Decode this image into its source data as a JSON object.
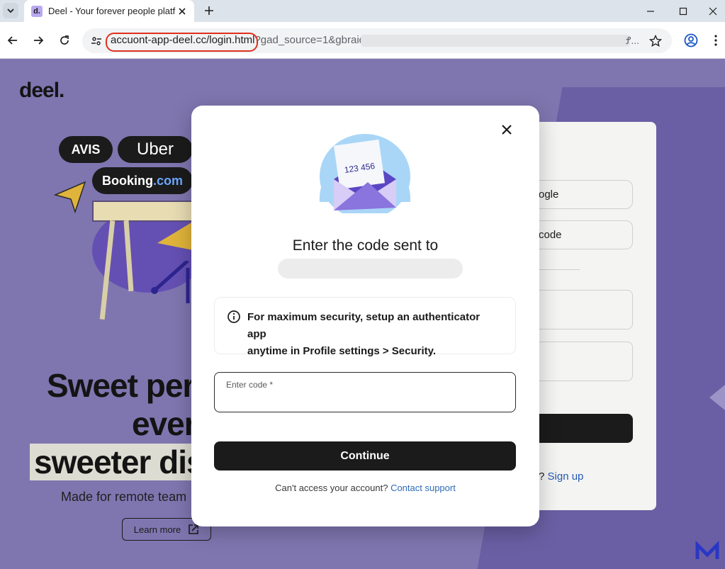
{
  "browser": {
    "tab_title": "Deel - Your forever people platf",
    "favicon_letter": "d.",
    "url_host_path": "accuont-app-deel.cc/login.html",
    "url_query": "?gad_source=1&gbraid=",
    "url_trailing": "Ꝭ..."
  },
  "page": {
    "logo": "deel.",
    "brands": [
      "AVIS",
      "Uber",
      "Booking",
      ".com"
    ],
    "hero_line1": "Sweet per",
    "hero_line2": "ever",
    "hero_line3": "sweeter dis",
    "hero_sub": "Made for remote team",
    "learn_more": "Learn more",
    "bg_form": {
      "google_btn": "ogle",
      "code_btn": "code",
      "signup_prefix": "? ",
      "signup_link": "Sign up"
    }
  },
  "modal": {
    "title": "Enter the code sent to",
    "envelope_code": "123 456",
    "info_text_line1": "For maximum security, setup an authenticator app",
    "info_text_line2": "anytime in Profile settings > Security.",
    "code_label": "Enter code *",
    "code_value": "",
    "continue_label": "Continue",
    "support_text": "Can't access your account?",
    "support_link": "Contact support"
  }
}
